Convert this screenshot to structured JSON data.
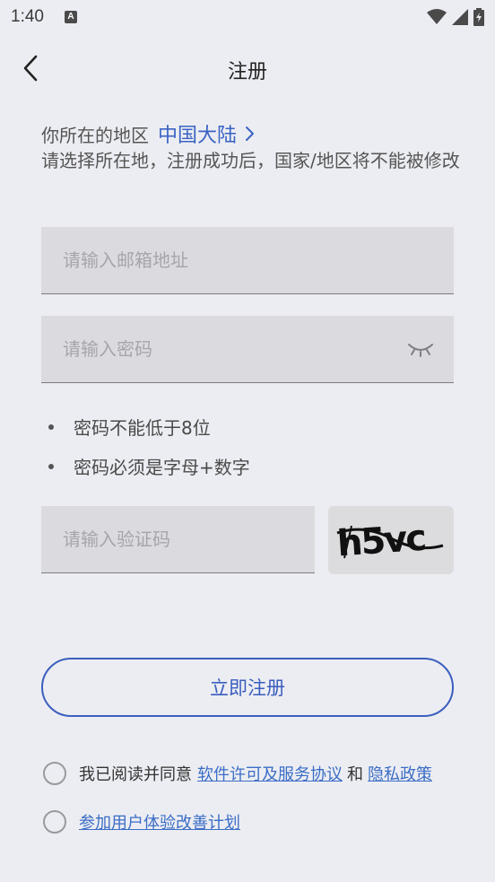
{
  "status_bar": {
    "time": "1:40",
    "app_icon_letter": "A",
    "icons": [
      "wifi-icon",
      "signal-icon",
      "battery-icon"
    ]
  },
  "header": {
    "title": "注册",
    "back_icon": "chevron-left-icon"
  },
  "region": {
    "label": "你所在的地区",
    "value": "中国大陆",
    "note": "请选择所在地，注册成功后，国家/地区将不能被修改"
  },
  "form": {
    "email_placeholder": "请输入邮箱地址",
    "password_placeholder": "请输入密码",
    "password_rules": [
      "密码不能低于8位",
      "密码必须是字母+数字"
    ],
    "captcha_placeholder": "请输入验证码",
    "captcha_text": "h5vc"
  },
  "register_button": "立即注册",
  "agreements": {
    "prefix": "我已阅读并同意",
    "license_link": "软件许可及服务协议",
    "and_text": "和",
    "privacy_link": "隐私政策",
    "experience_link": "参加用户体验改善计划"
  },
  "colors": {
    "background": "#ecedf2",
    "accent": "#3b5fbe",
    "input_background": "#dbdbdf"
  }
}
